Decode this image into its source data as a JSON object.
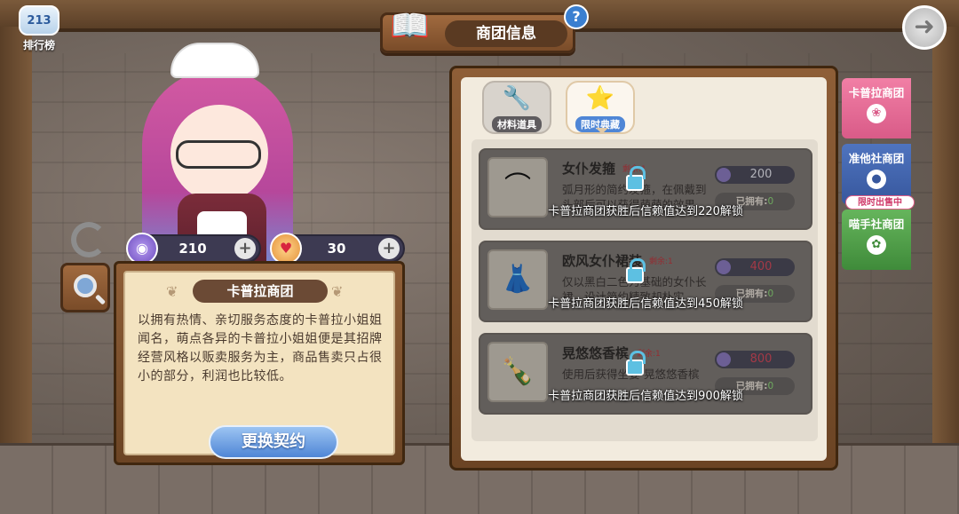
{
  "ranking": {
    "badge": "213",
    "label": "排行榜"
  },
  "header": {
    "title": "商团信息",
    "help": "?",
    "back": "➜"
  },
  "currencies": [
    {
      "icon": "purple-coin-icon",
      "value": "210",
      "plus": "+"
    },
    {
      "icon": "heart-token-icon",
      "value": "30",
      "plus": "+"
    }
  ],
  "guild": {
    "name": "卡普拉商团",
    "description": "以拥有热情、亲切服务态度的卡普拉小姐姐闻名，萌点各异的卡普拉小姐姐便是其招牌经营风格以贩卖服务为主，商品售卖只占很小的部分，利润也比较低。",
    "contract_button": "更换契约"
  },
  "tabs": [
    {
      "label": "材料道具",
      "icon": "wrench-flask-icon"
    },
    {
      "label": "限时典藏",
      "icon": "star-folder-icon"
    }
  ],
  "items": [
    {
      "name": "女仆发箍",
      "remain": "剩余:1",
      "desc": "弧月形的简约发箍，在佩戴到头部后可以获得萌萌的效果",
      "price": "200",
      "owned_label": "已拥有:",
      "owned_value": "0",
      "unlock": "卡普拉商团获胜后信赖值达到220解锁"
    },
    {
      "name": "欧风女仆裙装",
      "remain": "剩余:1",
      "desc": "仅以黑白二色为基础的女仆长裙，设计简约精致却朴实",
      "price": "400",
      "owned_label": "已拥有:",
      "owned_value": "0",
      "unlock": "卡普拉商团获胜后信赖值达到450解锁"
    },
    {
      "name": "晃悠悠香槟",
      "remain": "剩余:1",
      "desc": "使用后获得坐姿-晃悠悠香槟",
      "price": "800",
      "owned_label": "已拥有:",
      "owned_value": "0",
      "unlock": "卡普拉商团获胜后信赖值达到900解锁"
    }
  ],
  "side_flags": [
    {
      "label": "卡普拉商团",
      "icon": "bunny-icon"
    },
    {
      "label": "准他社商团",
      "icon": "cookie-icon"
    },
    {
      "label": "喵手社商团",
      "icon": "paw-icon"
    }
  ],
  "limited_tag": "限时出售中",
  "colors": {
    "accent_blue": "#4f86d6",
    "lock_blue": "#5dc0e2",
    "price_red": "#c6394a"
  }
}
